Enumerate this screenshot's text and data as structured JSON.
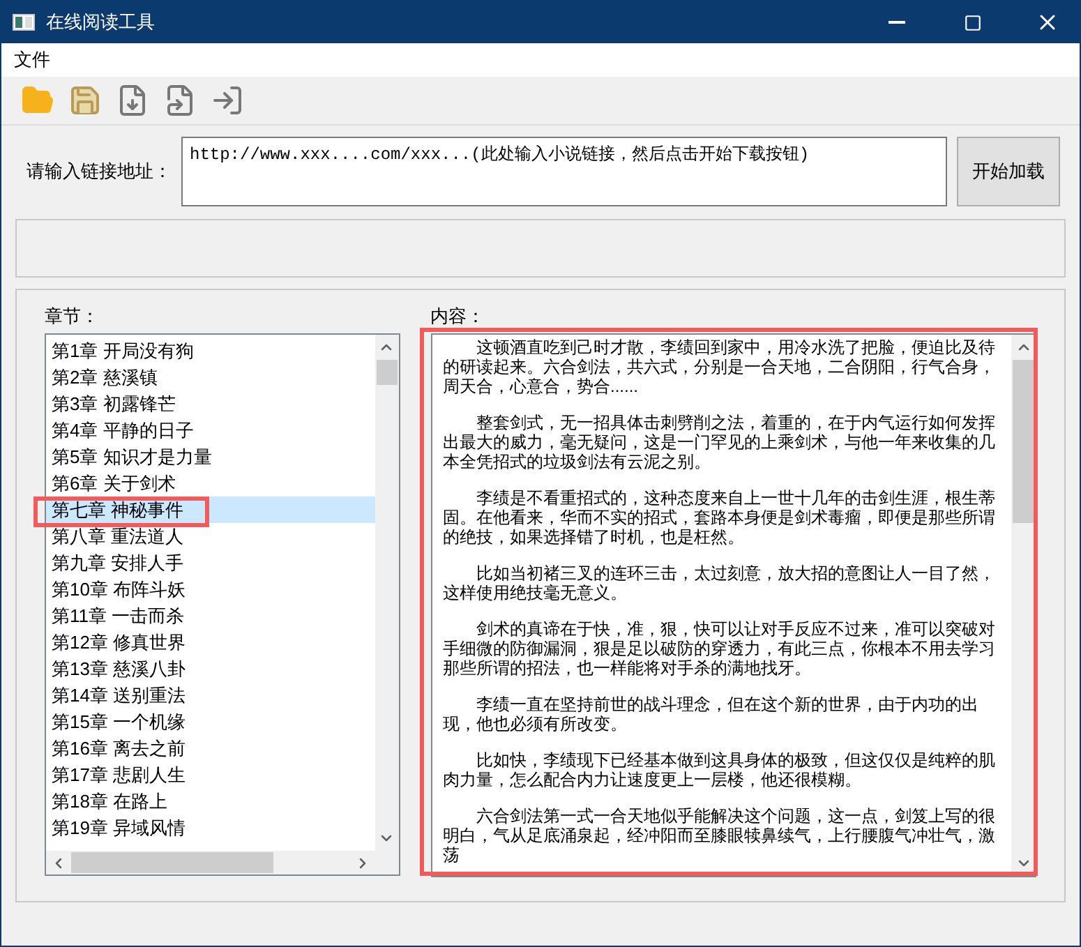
{
  "window": {
    "title": "在线阅读工具"
  },
  "menu": [
    "文件"
  ],
  "url_input": {
    "label": "请输入链接地址：",
    "value": "http://www.xxx....com/xxx...(此处输入小说链接，然后点击开始下载按钮)"
  },
  "load_button": "开始加载",
  "chapters": {
    "label": "章节：",
    "highlighted": true,
    "items": [
      {
        "title": "第1章 开局没有狗",
        "selected": false
      },
      {
        "title": "第2章 慈溪镇",
        "selected": false
      },
      {
        "title": "第3章 初露锋芒",
        "selected": false
      },
      {
        "title": "第4章 平静的日子",
        "selected": false
      },
      {
        "title": "第5章 知识才是力量",
        "selected": false
      },
      {
        "title": "第6章 关于剑术",
        "selected": false
      },
      {
        "title": "第七章 神秘事件",
        "selected": true
      },
      {
        "title": "第八章 重法道人",
        "selected": false
      },
      {
        "title": "第九章 安排人手",
        "selected": false
      },
      {
        "title": "第10章 布阵斗妖",
        "selected": false
      },
      {
        "title": "第11章 一击而杀",
        "selected": false
      },
      {
        "title": "第12章 修真世界",
        "selected": false
      },
      {
        "title": "第13章 慈溪八卦",
        "selected": false
      },
      {
        "title": "第14章 送别重法",
        "selected": false
      },
      {
        "title": "第15章 一个机缘",
        "selected": false
      },
      {
        "title": "第16章 离去之前",
        "selected": false
      },
      {
        "title": "第17章 悲剧人生",
        "selected": false
      },
      {
        "title": "第18章 在路上",
        "selected": false
      },
      {
        "title": "第19章 异域风情",
        "selected": false
      }
    ]
  },
  "content": {
    "label": "内容：",
    "highlighted": true,
    "paragraphs": [
      "这顿酒直吃到己时才散，李绩回到家中，用冷水洗了把脸，便迫比及待的研读起来。六合剑法，共六式，分别是一合天地，二合阴阳，行气合身，周天合，心意合，势合......",
      "整套剑式，无一招具体击刺劈削之法，着重的，在于内气运行如何发挥出最大的威力，毫无疑问，这是一门罕见的上乘剑术，与他一年来收集的几本全凭招式的垃圾剑法有云泥之别。",
      "李绩是不看重招式的，这种态度来自上一世十几年的击剑生涯，根生蒂固。在他看来，华而不实的招式，套路本身便是剑术毒瘤，即便是那些所谓的绝技，如果选择错了时机，也是枉然。",
      "比如当初褚三叉的连环三击，太过刻意，放大招的意图让人一目了然，这样使用绝技毫无意义。",
      "剑术的真谛在于快，准，狠，快可以让对手反应不过来，准可以突破对手细微的防御漏洞，狠是足以破防的穿透力，有此三点，你根本不用去学习那些所谓的招法，也一样能将对手杀的满地找牙。",
      "李绩一直在坚持前世的战斗理念，但在这个新的世界，由于内功的出现，他也必须有所改变。",
      "比如快，李绩现下已经基本做到这具身体的极致，但这仅仅是纯粹的肌肉力量，怎么配合内力让速度更上一层楼，他还很模糊。",
      "六合剑法第一式一合天地似乎能解决这个问题，这一点，剑笈上写的很明白，气从足底涌泉起，经冲阳而至膝眼犊鼻续气，上行腰腹气冲壮气，激荡"
    ]
  }
}
